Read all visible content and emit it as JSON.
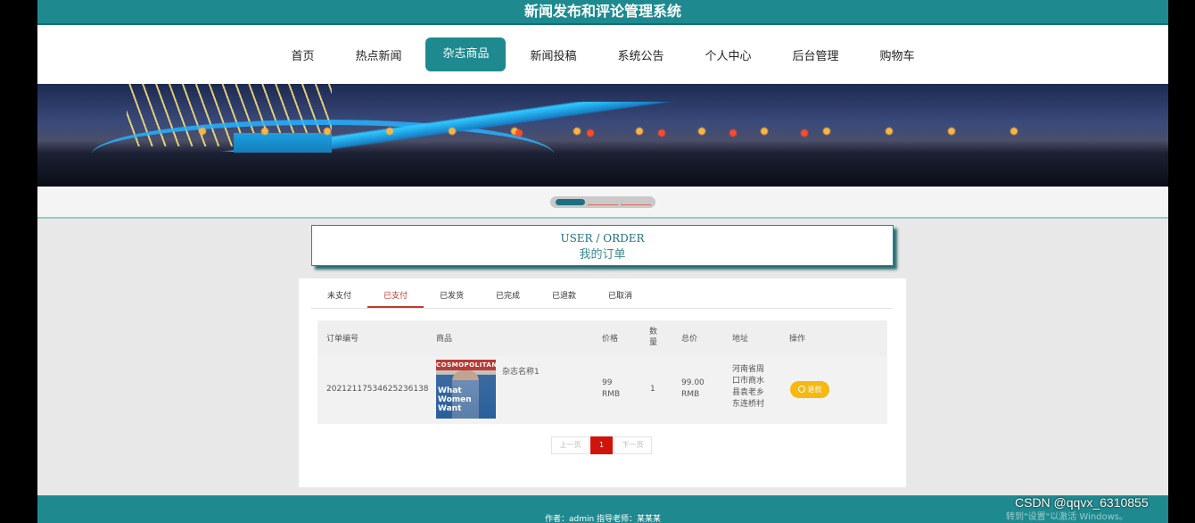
{
  "site_title": "新闻发布和评论管理系统",
  "nav": [
    "首页",
    "热点新闻",
    "杂志商品",
    "新闻投稿",
    "系统公告",
    "个人中心",
    "后台管理",
    "购物车"
  ],
  "nav_active_index": 2,
  "banner": {
    "subject": "night bridge photo"
  },
  "carousel": {
    "active_index": 0,
    "count": 3
  },
  "order_heading": {
    "en": "USER / ORDER",
    "cn": "我的订单"
  },
  "tabs": [
    "未支付",
    "已支付",
    "已发货",
    "已完成",
    "已退款",
    "已取消"
  ],
  "tabs_active_index": 1,
  "table": {
    "columns": [
      "订单编号",
      "商品",
      "价格",
      "数\n量",
      "总价",
      "地址",
      "操作"
    ],
    "rows": [
      {
        "order_no": "20212117534625236138",
        "product_name": "杂志名称1",
        "product_cover": {
          "masthead": "COSMOPOLITAN",
          "cover_text": "What Women Want"
        },
        "price": "99\nRMB",
        "quantity": "1",
        "total": "99.00\nRMB",
        "address": "河南省周\n口市商水\n县袁老乡\n东连桥村",
        "action": "退款"
      }
    ]
  },
  "pagination": {
    "prev": "上一页",
    "current": "1",
    "next": "下一页"
  },
  "footer": "作者：admin 指导老师：某某某",
  "watermark": "CSDN @qqvx_6310855",
  "activate_hint": "转到\"设置\"以激活 Windows。",
  "colors": {
    "primary": "#1e8a8f",
    "active_tab": "#c0392b",
    "refund_button": "#f5b90f",
    "page_current": "#d0140c"
  }
}
